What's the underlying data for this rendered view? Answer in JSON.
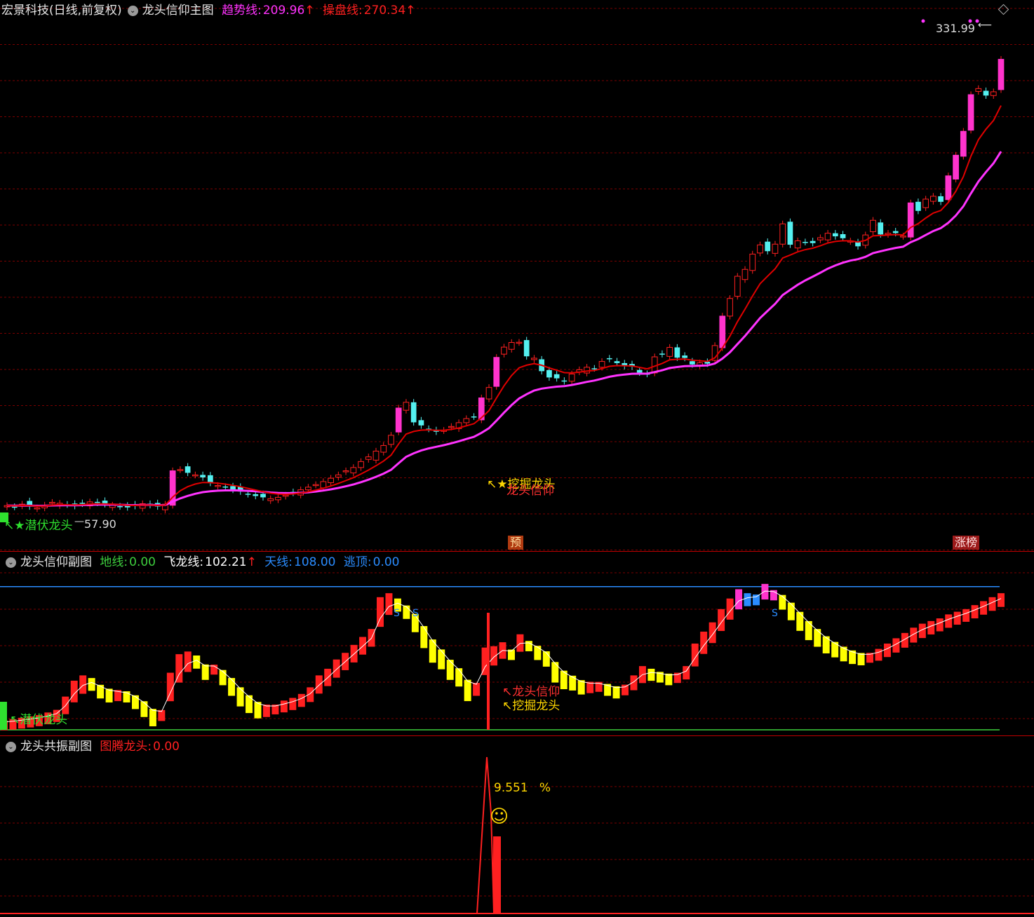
{
  "main_header": {
    "stock_title": "宏景科技(日线,前复权)",
    "indicator_name": "龙头信仰主图",
    "trend_label": "趋势线:",
    "trend_value": "209.96",
    "trend_arrow": "↑",
    "control_label": "操盘线:",
    "control_value": "270.34",
    "control_arrow": "↑"
  },
  "main_annotations": {
    "high_price": "331.99",
    "low_price": "57.90",
    "latent_dragon": "潜伏龙头",
    "dig_dragon": "挖掘龙头",
    "dragon_faith": "龙头信仰",
    "pre_tag": "预",
    "limit_up_tag": "涨榜"
  },
  "sub1_header": {
    "indicator_name": "龙头信仰副图",
    "ground_label": "地线:",
    "ground_value": "0.00",
    "flying_label": "飞龙线:",
    "flying_value": "102.21",
    "flying_arrow": "↑",
    "sky_label": "天线:",
    "sky_value": "108.00",
    "escape_label": "逃顶:",
    "escape_value": "0.00"
  },
  "sub1_annotations": {
    "dragon_faith": "龙头信仰",
    "dig_dragon": "挖掘龙头",
    "latent_dragon": "潜伏龙头",
    "s_mark": "S"
  },
  "sub2_header": {
    "indicator_name": "龙头共振副图",
    "totem_label": "图腾龙头:",
    "totem_value": "0.00"
  },
  "sub2_annotations": {
    "percent_value": "9.551",
    "percent_sign": "%",
    "smiley": "☺"
  },
  "colors": {
    "background": "#000000",
    "rise": "#ff2020",
    "rise_fill": "#ff33cc",
    "fall": "#54f0f0",
    "trend": "#ff33ff",
    "control": "#e00000",
    "sky": "#2a8cff",
    "ground": "#3ecf3e",
    "yellow": "#ffff00",
    "grid": "#7a0000"
  },
  "chart_data": [
    {
      "type": "candlestick",
      "title": "龙头信仰主图",
      "ylim": [
        55,
        340
      ],
      "annotated_high": 331.99,
      "annotated_low": 57.9,
      "closes": [
        58.5,
        58.2,
        58.8,
        58.3,
        58.0,
        58.6,
        59.2,
        59.0,
        58.7,
        58.4,
        58.9,
        59.3,
        59.1,
        58.8,
        58.6,
        58.3,
        58.1,
        58.4,
        58.9,
        58.6,
        58.3,
        58.8,
        66.5,
        66.8,
        66.0,
        65.5,
        64.9,
        63.6,
        63.0,
        62.6,
        62.0,
        61.6,
        61.0,
        60.6,
        60.3,
        60.0,
        60.3,
        60.8,
        61.3,
        62.0,
        62.6,
        63.2,
        63.9,
        64.7,
        65.5,
        66.5,
        67.3,
        68.8,
        70.0,
        71.5,
        73.0,
        75.8,
        83.8,
        85.6,
        79.5,
        78.6,
        77.6,
        76.8,
        77.2,
        78.3,
        79.4,
        80.6,
        81.2,
        87.0,
        90.4,
        101.0,
        104.9,
        106.7,
        106.8,
        101.4,
        100.7,
        96.0,
        93.8,
        93.5,
        92.5,
        95.0,
        96.5,
        97.4,
        97.0,
        99.5,
        100.4,
        98.9,
        97.8,
        97.6,
        95.5,
        95.0,
        101.2,
        102.2,
        104.8,
        100.9,
        100.8,
        98.4,
        99.0,
        98.7,
        105.5,
        117.6,
        125.5,
        136.2,
        139.7,
        147.8,
        152.9,
        149.4,
        153.3,
        165.2,
        153.0,
        155.2,
        154.5,
        153.9,
        157.0,
        159.6,
        157.8,
        156.7,
        155.1,
        152.1,
        158.6,
        167.4,
        158.9,
        159.6,
        159.7,
        158.0,
        178.5,
        173.3,
        181.0,
        182.9,
        179.2,
        197.2,
        212.8,
        232.4,
        266.0,
        272.0,
        265.1,
        268.8,
        303.0
      ],
      "trend_line_label": "趋势线",
      "trend_line_last": 209.96,
      "control_line_label": "操盘线",
      "control_line_last": 270.34
    },
    {
      "type": "bar",
      "title": "龙头信仰副图",
      "ylim": [
        0,
        110
      ],
      "reference_lines": {
        "地线": 0,
        "天线": 108
      },
      "last_value": 102.21,
      "values": [
        6,
        7,
        8,
        9,
        10,
        12,
        14,
        24,
        36,
        40,
        38,
        30,
        27,
        28,
        27,
        22,
        16,
        9,
        13,
        42,
        56,
        58,
        55,
        44,
        48,
        40,
        32,
        24,
        19,
        15,
        16,
        18,
        21,
        23,
        26,
        31,
        40,
        45,
        52,
        57,
        63,
        69,
        75,
        99,
        102,
        98,
        90,
        80,
        68,
        57,
        52,
        44,
        39,
        28,
        32,
        61,
        62,
        65,
        59,
        71,
        66,
        59,
        54,
        42,
        37,
        36,
        33,
        34,
        35,
        32,
        30,
        33,
        40,
        47,
        45,
        42,
        40,
        42,
        47,
        64,
        73,
        80,
        90,
        98,
        105,
        102,
        101,
        109,
        104,
        97,
        89,
        81,
        74,
        69,
        64,
        61,
        58,
        56,
        55,
        57,
        60,
        64,
        68,
        72,
        76,
        79,
        81,
        83,
        86,
        88,
        90,
        93,
        96,
        99,
        102
      ]
    },
    {
      "type": "line",
      "title": "龙头共振副图",
      "series_name": "图腾龙头",
      "last_value": 0.0,
      "annotated_percent": 9.551
    }
  ]
}
